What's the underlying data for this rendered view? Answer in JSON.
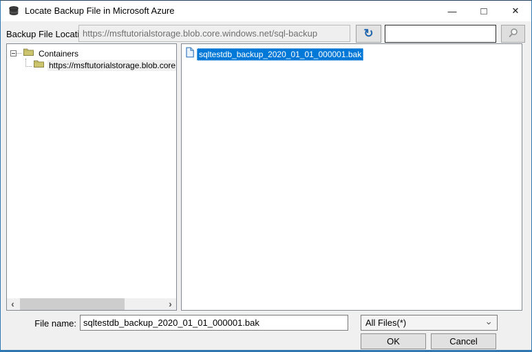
{
  "window": {
    "title": "Locate Backup File in Microsoft Azure",
    "controls": {
      "minimize": "—",
      "maximize": "□",
      "close": "✕"
    }
  },
  "location_bar": {
    "label": "Backup File Location",
    "value": "https://msftutorialstorage.blob.core.windows.net/sql-backup"
  },
  "search": {
    "value": "",
    "placeholder": ""
  },
  "icons": {
    "refresh": "↻",
    "chevron_down": "⌄",
    "scroll_left": "‹",
    "scroll_right": "›"
  },
  "tree": {
    "items": [
      {
        "label": "Containers"
      },
      {
        "label": "https://msftutorialstorage.blob.core.windo"
      }
    ]
  },
  "files": {
    "items": [
      {
        "label": "sqltestdb_backup_2020_01_01_000001.bak"
      }
    ]
  },
  "file_name": {
    "label": "File name:",
    "value": "sqltestdb_backup_2020_01_01_000001.bak"
  },
  "file_type": {
    "selected": "All Files(*)"
  },
  "buttons": {
    "ok": "OK",
    "cancel": "Cancel"
  },
  "colors": {
    "selection": "#0078d7",
    "window_border": "#2e77b0",
    "folder": "#ccc56e"
  }
}
